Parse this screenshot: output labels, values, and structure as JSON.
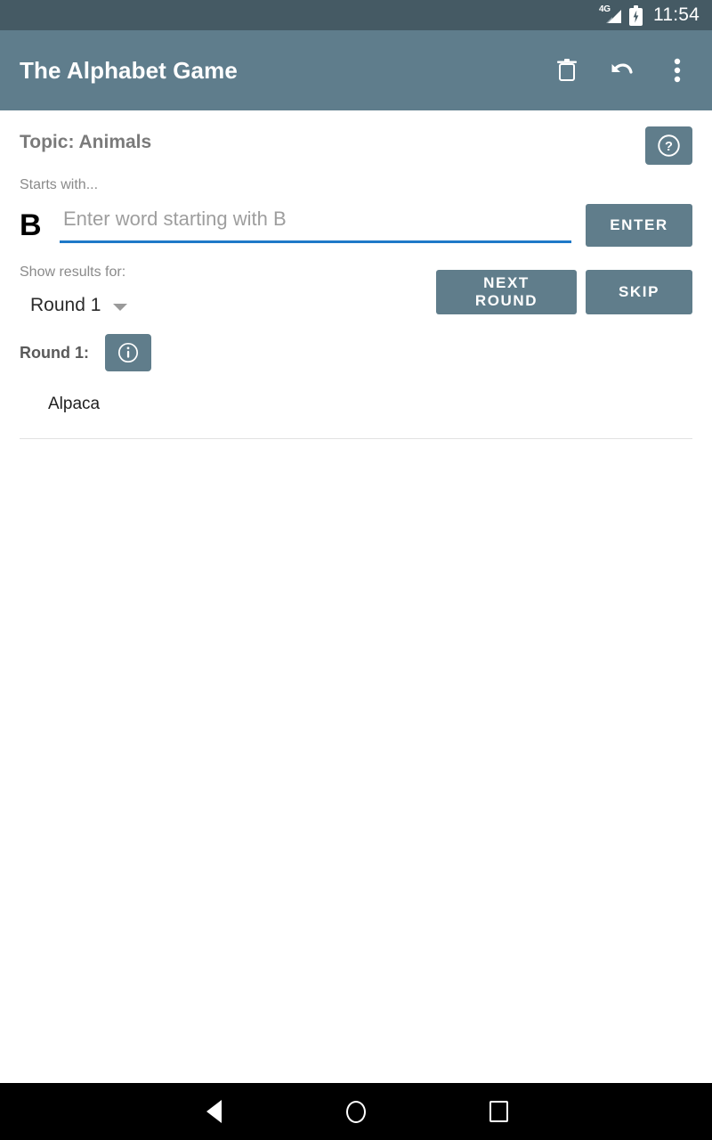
{
  "status_bar": {
    "network_label": "4G",
    "time": "11:54",
    "signal_icon": "signal-4g-icon",
    "battery_icon": "battery-charging-icon"
  },
  "app_bar": {
    "title": "The Alphabet Game",
    "actions": [
      {
        "name": "delete-icon",
        "label": "Delete"
      },
      {
        "name": "undo-icon",
        "label": "Undo"
      },
      {
        "name": "overflow-menu-icon",
        "label": "More options"
      }
    ]
  },
  "main": {
    "topic_label": "Topic: Animals",
    "help_button_label": "?",
    "starts_with_label": "Starts with...",
    "current_letter": "B",
    "input_placeholder": "Enter word starting with B",
    "input_value": "",
    "enter_label": "ENTER",
    "show_results_label": "Show results for:",
    "round_selector_value": "Round 1",
    "next_round_label": "NEXT ROUND",
    "skip_label": "SKIP",
    "round_header_label": "Round 1:",
    "info_button_label": "i",
    "words": [
      "Alpaca"
    ]
  },
  "nav_bar": {
    "back": "back-button",
    "home": "home-button",
    "recents": "recents-button"
  },
  "colors": {
    "status_bar": "#455A64",
    "app_bar": "#5F7D8C",
    "button": "#607D8B",
    "input_underline": "#1E79C8",
    "divider": "#e2e2e2"
  }
}
